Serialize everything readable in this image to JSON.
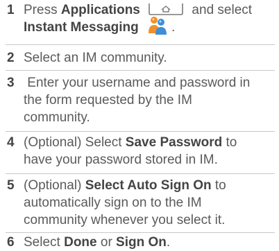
{
  "steps": [
    {
      "number": "1",
      "line1_a": "Press ",
      "line1_bold": "Applications",
      "line1_c": " and select",
      "line2_bold": "Instant Messaging",
      "line2_tail": "."
    },
    {
      "number": "2",
      "text": "Select an IM community."
    },
    {
      "number": "3",
      "lines": [
        " Enter your username and password in",
        "the form requested by the IM",
        "community."
      ]
    },
    {
      "number": "4",
      "line1_a": "(Optional) Select ",
      "line1_bold": "Save Password",
      "line1_c": " to",
      "line2": "have your password stored in IM."
    },
    {
      "number": "5",
      "line1_a": "(Optional) ",
      "line1_bold": "Select Auto Sign On",
      "line1_c": " to",
      "line2": "automatically sign on to the IM",
      "line3": "community whenever you select it."
    },
    {
      "number": "6",
      "a": "Select ",
      "bold1": "Done",
      "b": " or ",
      "bold2": "Sign On",
      "c": "."
    }
  ],
  "icons": {
    "applications_key": "applications-key-icon",
    "instant_messaging": "instant-messaging-icon"
  },
  "colors": {
    "text": "#5a5a5a",
    "number": "#444444",
    "rule": "#c8c8c8",
    "icon_orange": "#f0902a",
    "icon_blue": "#3d8fd8"
  }
}
